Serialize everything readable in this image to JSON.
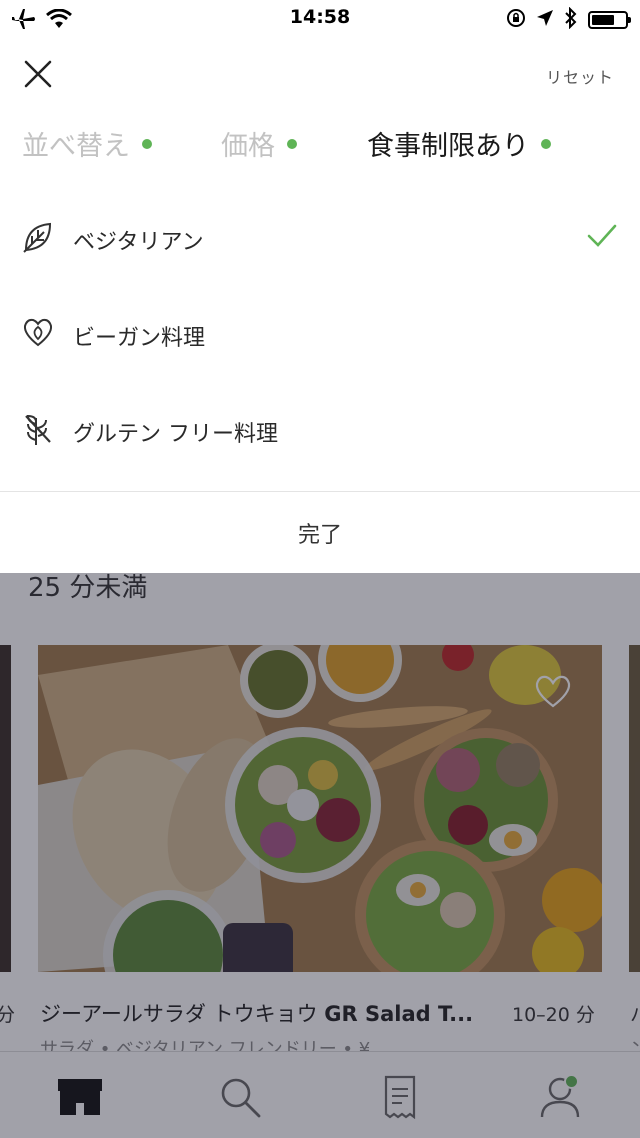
{
  "status_bar": {
    "time": "14:58",
    "left_icons": [
      "airplane-icon",
      "wifi-icon"
    ],
    "right_icons": [
      "orientation-lock-icon",
      "location-arrow-icon",
      "bluetooth-icon",
      "battery-icon"
    ],
    "battery_level": 0.7
  },
  "filter_sheet": {
    "close_icon": "close-icon",
    "reset_label": "リセット",
    "tabs": [
      {
        "label": "並べ替え",
        "active": false
      },
      {
        "label": "価格",
        "active": false
      },
      {
        "label": "食事制限あり",
        "active": true
      }
    ],
    "options": [
      {
        "label": "ベジタリアン",
        "icon": "leaf-icon",
        "selected": true
      },
      {
        "label": "ビーガン料理",
        "icon": "heart-leaf-icon",
        "selected": false
      },
      {
        "label": "グルテン フリー料理",
        "icon": "gluten-free-icon",
        "selected": false
      }
    ],
    "done_label": "完了",
    "accent_color": "#5fb456"
  },
  "background": {
    "section_heading": "25 分未満",
    "restaurant": {
      "name_jp": "ジーアールサラダ トウキョウ",
      "name_en": "GR Salad T...",
      "delivery_time": "10–20 分",
      "meta": "サラダ • ベジタリアン フレンドリー • ¥"
    },
    "left_edge_text": "分",
    "right_edge_text": "ハ",
    "right_edge_meta": "ン",
    "tabbar_icons": [
      "store-icon",
      "search-icon",
      "receipt-icon",
      "profile-icon"
    ]
  }
}
